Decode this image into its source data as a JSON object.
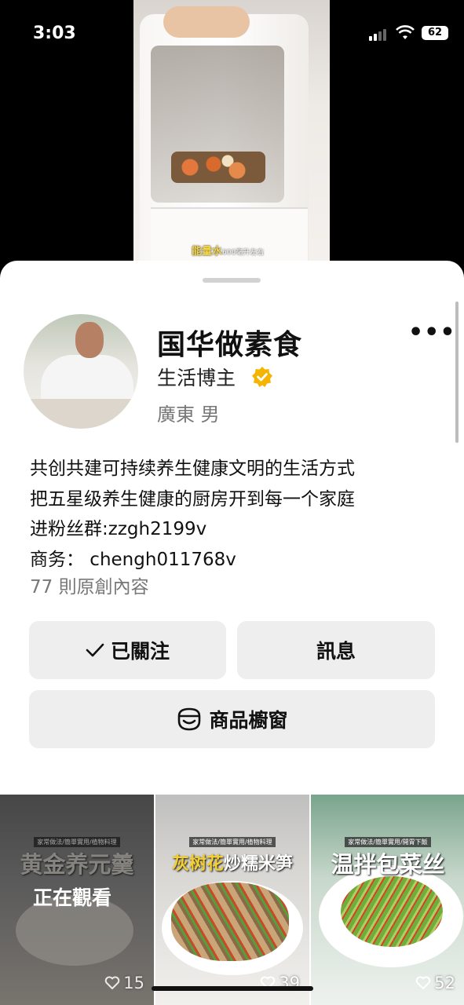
{
  "status_bar": {
    "time": "3:03",
    "battery": "62"
  },
  "video": {
    "subtitle_main": "能量水",
    "subtitle_small": "600毫升左右"
  },
  "profile": {
    "name": "国华做素食",
    "role": "生活博主",
    "location": "廣東 男",
    "bio": [
      "共创共建可持续养生健康文明的生活方式",
      "把五星级养生健康的厨房开到每一个家庭",
      "进粉丝群:zzgh2199v",
      "商务： chengh011768v"
    ],
    "content_count": "77 則原創內容"
  },
  "buttons": {
    "follow": "已關注",
    "message": "訊息",
    "shop": "商品櫥窗"
  },
  "grid": [
    {
      "tag": "家常做法/簡單實用/植物料理",
      "title": "黄金养元羹",
      "overlay": "正在觀看",
      "likes": "15"
    },
    {
      "tag": "家常做法/簡單實用/植物料理",
      "title_hl": "灰树花",
      "title": "炒糯米笋",
      "likes": "39"
    },
    {
      "tag": "家常做法/簡單實用/開胃下飯",
      "title": "温拌包菜丝",
      "likes": "52"
    }
  ],
  "colors": {
    "verified": "#f4b400",
    "button_bg": "#eeeeee"
  }
}
